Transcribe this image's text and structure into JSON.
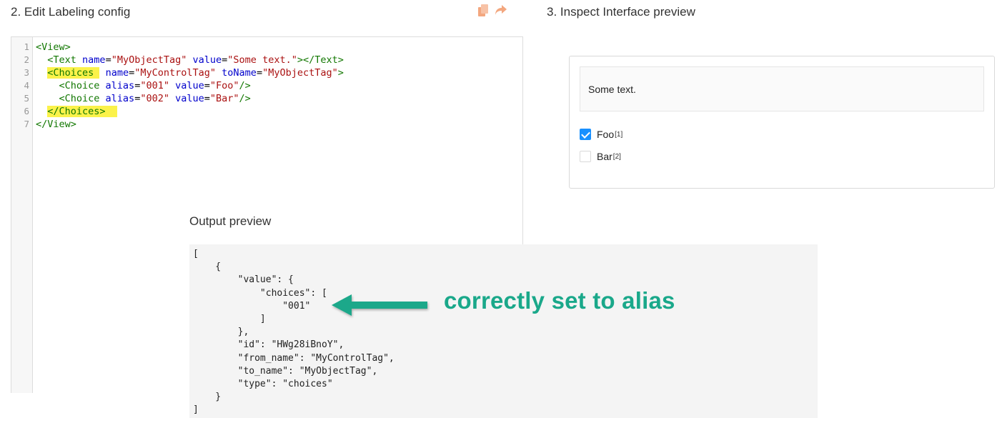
{
  "sections": {
    "edit_title": "2. Edit Labeling config",
    "inspect_title": "3. Inspect Interface preview",
    "output_title": "Output preview"
  },
  "toolbar": {
    "copy_icon": "copy-icon",
    "share_icon": "share-arrow-icon",
    "icon_color": "#f3a77f"
  },
  "editor": {
    "line_numbers": [
      "1",
      "2",
      "3",
      "4",
      "5",
      "6",
      "7"
    ],
    "lines": [
      [
        [
          "tag",
          "<View>"
        ]
      ],
      [
        [
          "pun",
          "  "
        ],
        [
          "tag",
          "<Text "
        ],
        [
          "attr",
          "name"
        ],
        [
          "pun",
          "="
        ],
        [
          "str",
          "\"MyObjectTag\""
        ],
        [
          "pun",
          " "
        ],
        [
          "attr",
          "value"
        ],
        [
          "pun",
          "="
        ],
        [
          "str",
          "\"Some text.\""
        ],
        [
          "tag",
          "></Text>"
        ]
      ],
      [
        [
          "pun",
          "  "
        ],
        [
          "taghl",
          "<Choices "
        ],
        [
          "pun",
          " "
        ],
        [
          "attr",
          "name"
        ],
        [
          "pun",
          "="
        ],
        [
          "str",
          "\"MyControlTag\""
        ],
        [
          "pun",
          " "
        ],
        [
          "attr",
          "toName"
        ],
        [
          "pun",
          "="
        ],
        [
          "str",
          "\"MyObjectTag\""
        ],
        [
          "tag",
          ">"
        ]
      ],
      [
        [
          "pun",
          "    "
        ],
        [
          "tag",
          "<Choice "
        ],
        [
          "attr",
          "alias"
        ],
        [
          "pun",
          "="
        ],
        [
          "str",
          "\"001\""
        ],
        [
          "pun",
          " "
        ],
        [
          "attr",
          "value"
        ],
        [
          "pun",
          "="
        ],
        [
          "str",
          "\"Foo\""
        ],
        [
          "tag",
          "/>"
        ]
      ],
      [
        [
          "pun",
          "    "
        ],
        [
          "tag",
          "<Choice "
        ],
        [
          "attr",
          "alias"
        ],
        [
          "pun",
          "="
        ],
        [
          "str",
          "\"002\""
        ],
        [
          "pun",
          " "
        ],
        [
          "attr",
          "value"
        ],
        [
          "pun",
          "="
        ],
        [
          "str",
          "\"Bar\""
        ],
        [
          "tag",
          "/>"
        ]
      ],
      [
        [
          "pun",
          "  "
        ],
        [
          "taghl",
          "</Choices>  "
        ]
      ],
      [
        [
          "tag",
          "</View>"
        ]
      ]
    ]
  },
  "preview": {
    "text": "Some text.",
    "choices": [
      {
        "label": "Foo",
        "hotkey": "[1]",
        "checked": true
      },
      {
        "label": "Bar",
        "hotkey": "[2]",
        "checked": false
      }
    ]
  },
  "output": {
    "lines": [
      "[",
      "    {",
      "        \"value\": {",
      "            \"choices\": [",
      "                \"001\"",
      "            ]",
      "        },",
      "        \"id\": \"HWg28iBnoY\",",
      "        \"from_name\": \"MyControlTag\",",
      "        \"to_name\": \"MyObjectTag\",",
      "        \"type\": \"choices\"",
      "    }",
      "]"
    ]
  },
  "annotation": {
    "text": "correctly set to alias",
    "color": "#1aa88a"
  }
}
